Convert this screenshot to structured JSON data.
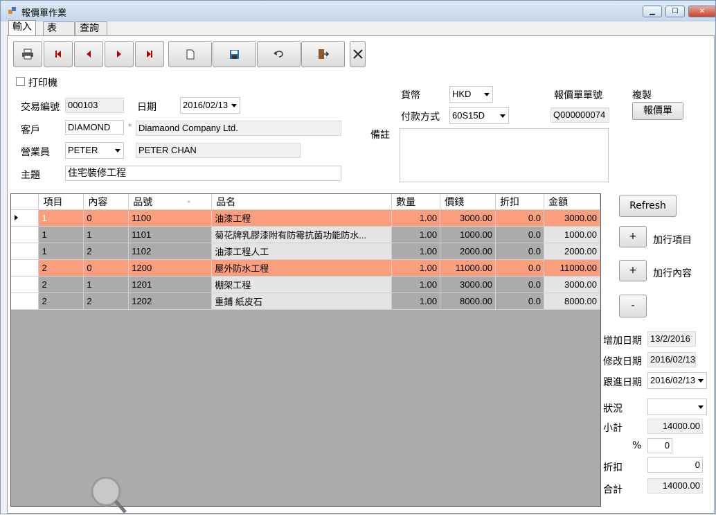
{
  "window": {
    "title": "報價單作業",
    "min": "▁",
    "max": "☐",
    "close": "✕"
  },
  "tabs": [
    {
      "label": "輸入"
    },
    {
      "label": "表"
    },
    {
      "label": "查詢"
    }
  ],
  "toolbar": {
    "print": "print-icon",
    "first": "first-icon",
    "prev": "prev-icon",
    "next": "next-icon",
    "last": "last-icon",
    "new": "new-doc-icon",
    "save": "save-icon",
    "undo": "undo-icon",
    "exit": "exit-icon",
    "delete": "delete-icon"
  },
  "form": {
    "printer_label": "打印機",
    "txn_no_label": "交易編號",
    "txn_no": "000103",
    "date_label": "日期",
    "date": "2016/02/13",
    "customer_label": "客戶",
    "customer_code": "DIAMOND",
    "customer_star": "*",
    "customer_name": "Diamaond Company Ltd.",
    "sales_label": "營業員",
    "sales_code": "PETER",
    "sales_name": "PETER CHAN",
    "subject_label": "主題",
    "subject": "住宅裝修工程",
    "currency_label": "貨幣",
    "currency": "HKD",
    "payment_label": "付款方式",
    "payment": "60S15D",
    "quote_no_label": "報價單單號",
    "quote_no": "Q000000074",
    "copy_label": "複製",
    "copy_button": "報價單",
    "remarks_label": "備註",
    "remarks": ""
  },
  "grid": {
    "columns": [
      "項目",
      "內容",
      "品號",
      "品名",
      "數量",
      "價錢",
      "折扣",
      "金額"
    ],
    "code_star": "*",
    "rows": [
      {
        "item": "1",
        "content": "0",
        "code": "1100",
        "name": "油漆工程",
        "qty": "1.00",
        "price": "3000.00",
        "disc": "0.0",
        "amount": "3000.00",
        "hl": true,
        "current": true
      },
      {
        "item": "1",
        "content": "1",
        "code": "1101",
        "name": "菊花牌乳膠漆附有防霉抗菌功能防水...",
        "qty": "1.00",
        "price": "1000.00",
        "disc": "0.0",
        "amount": "1000.00",
        "hl": false
      },
      {
        "item": "1",
        "content": "2",
        "code": "1102",
        "name": "油漆工程人工",
        "qty": "1.00",
        "price": "2000.00",
        "disc": "0.0",
        "amount": "2000.00",
        "hl": false
      },
      {
        "item": "2",
        "content": "0",
        "code": "1200",
        "name": "屋外防水工程",
        "qty": "1.00",
        "price": "11000.00",
        "disc": "0.0",
        "amount": "11000.00",
        "hl": true
      },
      {
        "item": "2",
        "content": "1",
        "code": "1201",
        "name": "棚架工程",
        "qty": "1.00",
        "price": "3000.00",
        "disc": "0.0",
        "amount": "3000.00",
        "hl": false
      },
      {
        "item": "2",
        "content": "2",
        "code": "1202",
        "name": "重鋪 紙皮石",
        "qty": "1.00",
        "price": "8000.00",
        "disc": "0.0",
        "amount": "8000.00",
        "hl": false
      }
    ]
  },
  "side": {
    "refresh": "Refresh",
    "add_item_btn": "+",
    "add_item_label": "加行項目",
    "add_content_btn": "+",
    "add_content_label": "加行內容",
    "remove_btn": "-",
    "created_label": "增加日期",
    "created": "13/2/2016",
    "modified_label": "修改日期",
    "modified": "2016/02/13",
    "followup_label": "跟進日期",
    "followup": "2016/02/13",
    "status_label": "狀況",
    "status": "",
    "subtotal_label": "小計",
    "subtotal": "14000.00",
    "pct_label": "%",
    "pct": "0",
    "discount_label": "折扣",
    "discount": "0",
    "total_label": "合計",
    "total": "14000.00"
  }
}
